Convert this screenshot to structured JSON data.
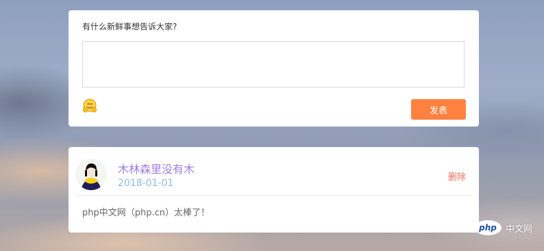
{
  "composer": {
    "prompt": "有什么新鲜事想告诉大家?",
    "emoji_icon": "hugging-face-emoji-icon",
    "publish_label": "发表",
    "publish_color": "#ff8140"
  },
  "feed": {
    "items": [
      {
        "username": "木林森里没有木",
        "date": "2018-01-01",
        "delete_label": "删除",
        "content": "php中文网（php.cn）太棒了！"
      }
    ]
  },
  "watermark": {
    "logo": "php",
    "text": "中文网"
  },
  "colors": {
    "username": "#9c7ee8",
    "date": "#8dbbe8",
    "delete": "#f06a5c"
  }
}
